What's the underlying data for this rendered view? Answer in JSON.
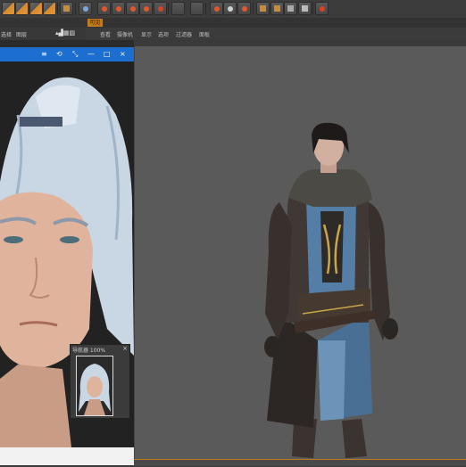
{
  "strip": {
    "tab_label": "可见"
  },
  "left_menu": {
    "items": [
      "选择",
      "图层"
    ]
  },
  "viewport_menu": {
    "items": [
      "查看",
      "摄像机",
      "显示",
      "选项",
      "过滤器",
      "面板"
    ]
  },
  "picture_viewer": {
    "title_icons": [
      "≡",
      "⟲",
      "⤡",
      "—",
      "□",
      "×"
    ]
  },
  "navigator": {
    "title": "导航器 100%",
    "close": "×"
  },
  "colors": {
    "accent": "#c07a20",
    "viewer_titlebar": "#1c6fd0",
    "viewport_bg": "#5a5a5a"
  }
}
